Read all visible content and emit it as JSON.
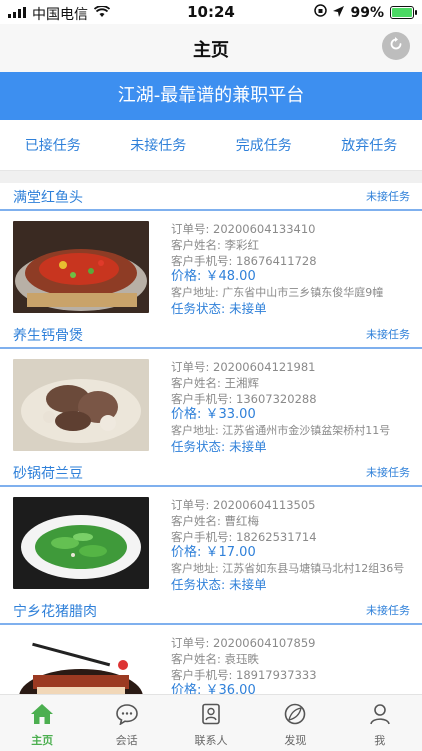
{
  "status_bar": {
    "carrier": "中国电信",
    "time": "10:24",
    "battery": "99%"
  },
  "nav": {
    "title": "主页",
    "refresh_icon": "refresh-icon"
  },
  "banner": {
    "text": "江湖-最靠谱的兼职平台"
  },
  "tabs": [
    {
      "label": "已接任务"
    },
    {
      "label": "未接任务"
    },
    {
      "label": "完成任务"
    },
    {
      "label": "放弃任务"
    }
  ],
  "orders": [
    {
      "title": "满堂红鱼头",
      "tag": "未接任务",
      "order_no": "订单号: 20200604133410",
      "customer": "客户姓名: 李彩红",
      "phone": "客户手机号: 18676411728",
      "price": "价格: ￥48.00",
      "address": "客户地址: 广东省中山市三乡镇东俊华庭9幢",
      "state": "任务状态: 未接单"
    },
    {
      "title": "养生钙骨煲",
      "tag": "未接任务",
      "order_no": "订单号: 20200604121981",
      "customer": "客户姓名: 王湘辉",
      "phone": "客户手机号: 13607320288",
      "price": "价格: ￥33.00",
      "address": "客户地址: 江苏省通州市金沙镇盆架桥村11号",
      "state": "任务状态: 未接单"
    },
    {
      "title": "砂锅荷兰豆",
      "tag": "未接任务",
      "order_no": "订单号: 20200604113505",
      "customer": "客户姓名: 曹红梅",
      "phone": "客户手机号: 18262531714",
      "price": "价格: ￥17.00",
      "address": "客户地址: 江苏省如东县马塘镇马北村12组36号",
      "state": "任务状态: 未接单"
    },
    {
      "title": "宁乡花猪腊肉",
      "tag": "未接任务",
      "order_no": "订单号: 20200604107859",
      "customer": "客户姓名: 袁珏眣",
      "phone": "客户手机号: 18917937333",
      "price": "价格: ￥36.00",
      "address": "",
      "state": ""
    }
  ],
  "tabbar": [
    {
      "label": "主页",
      "icon": "home-icon"
    },
    {
      "label": "会话",
      "icon": "chat-icon"
    },
    {
      "label": "联系人",
      "icon": "contacts-icon"
    },
    {
      "label": "发现",
      "icon": "discover-icon"
    },
    {
      "label": "我",
      "icon": "profile-icon"
    }
  ],
  "colors": {
    "accent": "#3d8ff0",
    "active_tab": "#4caf50"
  }
}
